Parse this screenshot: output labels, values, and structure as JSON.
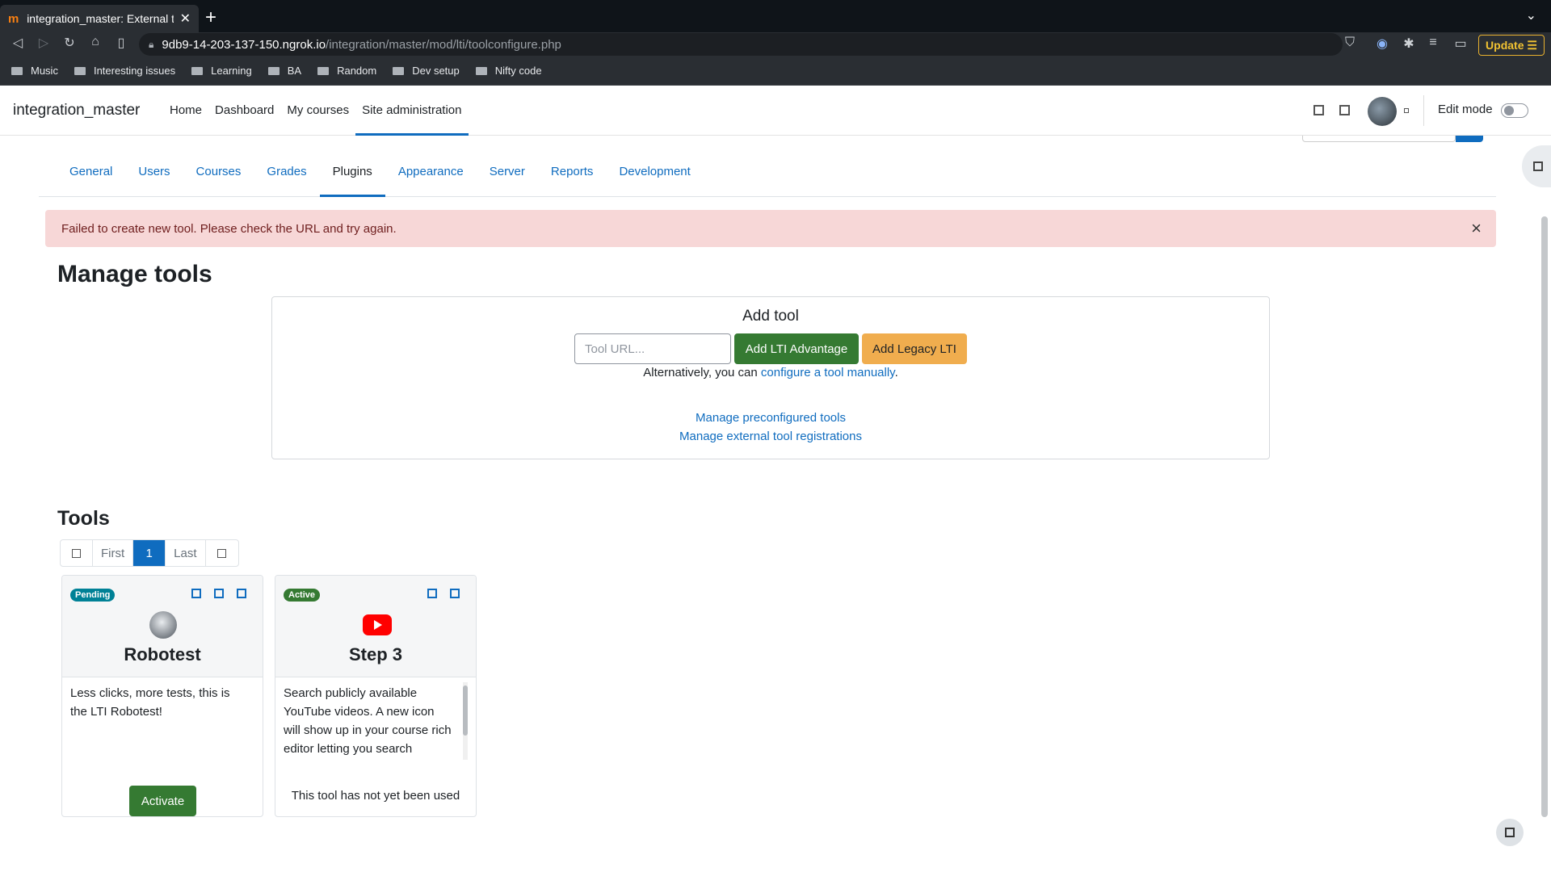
{
  "browser": {
    "tab_title": "integration_master: External tool",
    "tab_favicon": "m",
    "url_host": "9db9-14-203-137-150.ngrok.io",
    "url_path": "/integration/master/mod/lti/toolconfigure.php",
    "update_label": "Update",
    "bookmarks": [
      "Music",
      "Interesting issues",
      "Learning",
      "BA",
      "Random",
      "Dev setup",
      "Nifty code"
    ]
  },
  "navbar": {
    "site_name": "integration_master",
    "items": [
      "Home",
      "Dashboard",
      "My courses",
      "Site administration"
    ],
    "edit_mode_label": "Edit mode"
  },
  "admin_tabs": [
    "General",
    "Users",
    "Courses",
    "Grades",
    "Plugins",
    "Appearance",
    "Server",
    "Reports",
    "Development"
  ],
  "alert": {
    "message": "Failed to create new tool. Please check the URL and try again.",
    "close": "×"
  },
  "manage": {
    "heading": "Manage tools",
    "add_tool_title": "Add tool",
    "url_placeholder": "Tool URL...",
    "add_lti_advantage": "Add LTI Advantage",
    "add_legacy_lti": "Add Legacy LTI",
    "alt_prefix": "Alternatively, you can ",
    "alt_link": "configure a tool manually",
    "alt_suffix": ".",
    "preconfigured_link": "Manage preconfigured tools",
    "registrations_link": "Manage external tool registrations"
  },
  "tools": {
    "heading": "Tools",
    "pager": {
      "first": "First",
      "current": "1",
      "last": "Last"
    },
    "cards": [
      {
        "status": "Pending",
        "name": "Robotest",
        "description": "Less clicks, more tests, this is the LTI Robotest!",
        "action": "Activate"
      },
      {
        "status": "Active",
        "name": "Step 3",
        "description": "Search publicly available YouTube videos. A new icon will show up in your course rich editor letting you search",
        "usage": "This tool has not yet been used"
      }
    ]
  }
}
